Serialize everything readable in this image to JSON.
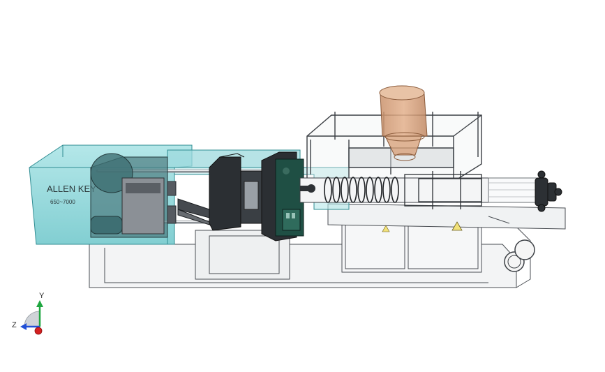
{
  "viewport": {
    "background": "#ffffff",
    "model": {
      "label_line1": "ALLEN KEY",
      "label_line2": "650~7000",
      "colors": {
        "housing": "#7fd3d6",
        "housing_edge": "#2f8c92",
        "mold_plate": "#2b2f33",
        "green_plate": "#1f4f44",
        "hopper": "#d9a27a",
        "hopper_edge": "#8a5a3a",
        "outline": "#3b3f44",
        "warning": "#f2e27a"
      }
    },
    "triad": {
      "x_label": "",
      "y_label": "Y",
      "z_label": "Z",
      "colors": {
        "x": "#d42020",
        "y": "#1fa640",
        "z": "#2250d6"
      }
    }
  }
}
